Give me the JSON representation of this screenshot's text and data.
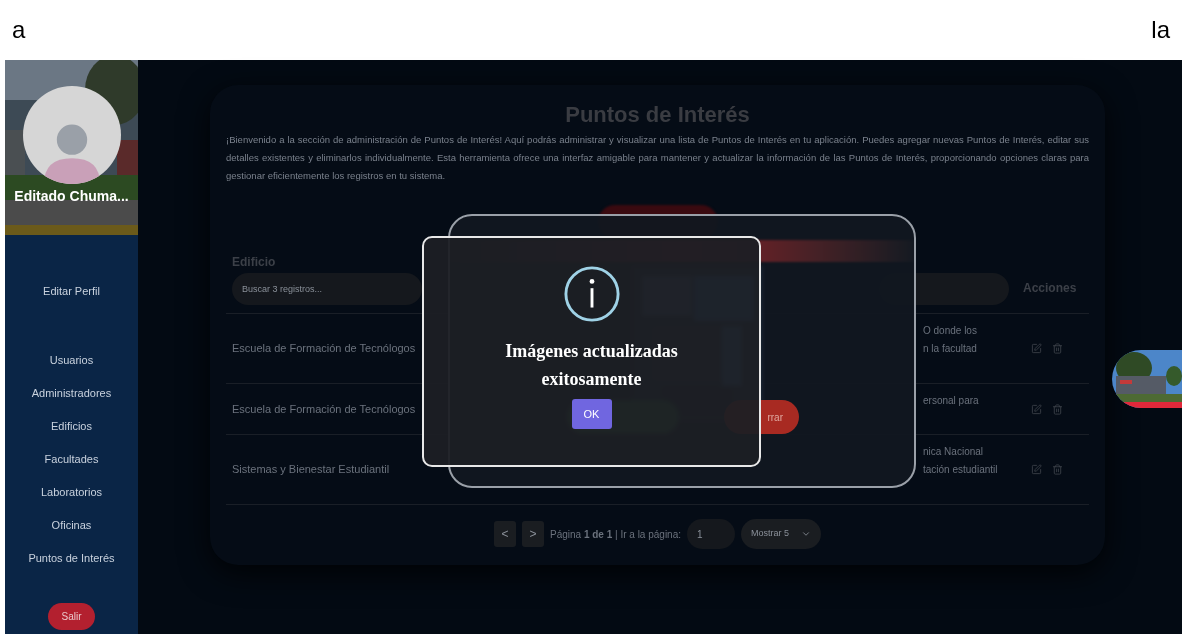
{
  "top_strip": {
    "left_text": "a",
    "right_text": "la"
  },
  "sidebar": {
    "user_name": "Editado Chuma...",
    "profile_link": "Editar Perfil",
    "items": [
      "Usuarios",
      "Administradores",
      "Edificios",
      "Facultades",
      "Laboratorios",
      "Oficinas",
      "Puntos de Interés"
    ],
    "logout": "Salir"
  },
  "page": {
    "title": "Puntos de Interés",
    "intro": "¡Bienvenido a la sección de administración de Puntos de Interés! Aquí podrás administrar y visualizar una lista de Puntos de Interés en tu aplicación. Puedes agregar nuevas Puntos de Interés, editar sus detalles existentes y eliminarlos individualmente. Esta herramienta ofrece una interfaz amigable para mantener y actualizar la información de las Puntos de Interés, proporcionando opciones claras para gestionar eficientemente los registros en tu sistema.",
    "table": {
      "first_column": {
        "label": "Edificio",
        "search_placeholder": "Buscar 3 registros..."
      },
      "last_column": {
        "label": "Acciones"
      },
      "rows": [
        {
          "building": "Escuela de Formación de Tecnólogos",
          "description": [
            "O donde los",
            "n la facultad"
          ]
        },
        {
          "building": "Escuela de Formación de Tecnólogos",
          "description": [
            "ersonal para"
          ]
        },
        {
          "building": "Sistemas y Bienestar Estudiantil",
          "description": [
            "nica Nacional",
            "tación estudiantil"
          ]
        }
      ]
    },
    "pagination": {
      "prev": "<",
      "next": ">",
      "summary": "Página **1 de 1** | Ir a la página:",
      "page_input": "1",
      "page_size": "Mostrar 5"
    }
  },
  "background_dialog": {
    "close_button": "rrar"
  },
  "alert": {
    "message": "Imágenes actualizadas exitosamente",
    "ok_button": "OK"
  }
}
